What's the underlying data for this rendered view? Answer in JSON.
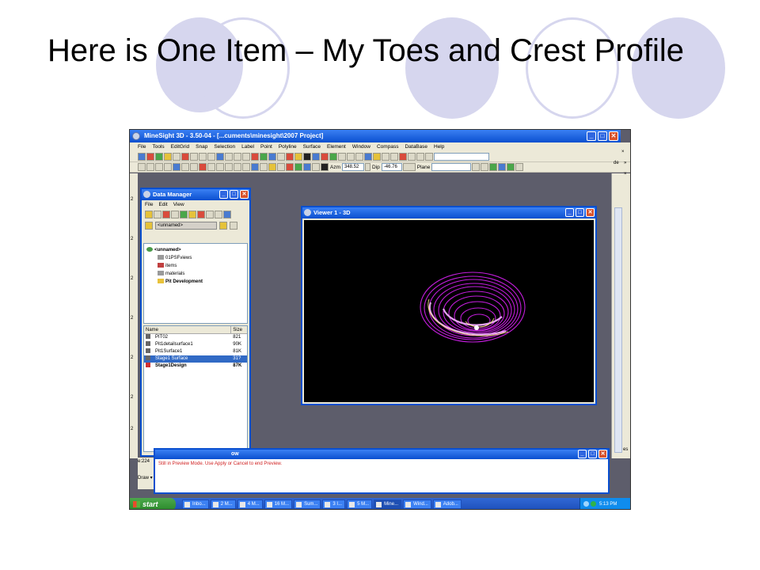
{
  "slide": {
    "title": "Here is One Item – My Toes and Crest Profile"
  },
  "app": {
    "window_title": "MineSight 3D  - 3.50-04 - [...cuments\\minesight\\2007 Project]",
    "menu": [
      "File",
      "Tools",
      "EditGrid",
      "Snap",
      "Selection",
      "Label",
      "Point",
      "Polyline",
      "Surface",
      "Element",
      "Window",
      "Compass",
      "DataBase",
      "Help"
    ],
    "toolbar2": {
      "azm_label": "Azm",
      "azm_value": "348.52",
      "dip_label": "Dip",
      "dip_value": "-46.76",
      "plane_label": "Plane"
    },
    "right_panel": {
      "de_label": "de",
      "es_label": "es"
    }
  },
  "data_manager": {
    "title": "Data Manager",
    "menu": [
      "File",
      "Edit",
      "View"
    ],
    "unnamed_field": "<unnamed>",
    "tree": {
      "root": "<unnamed>",
      "children": [
        "01PSFviews",
        "items",
        "materials",
        "Pit Development"
      ]
    },
    "list_headers": {
      "name": "Name",
      "size": "Size"
    },
    "list_rows": [
      {
        "name": "PIT02",
        "size": "821"
      },
      {
        "name": "Pit1detailsurface1",
        "size": "90K"
      },
      {
        "name": "Pit1Surface1",
        "size": "81K"
      },
      {
        "name": "Stage1 Surface",
        "size": "31?"
      },
      {
        "name": "Stage1Design",
        "size": "87K"
      }
    ]
  },
  "viewer": {
    "title": "Viewer 1 - 3D"
  },
  "message_window": {
    "title_partial": "ow",
    "message": "Still in Preview Mode. Use Apply or Cancel to end Preview."
  },
  "status": {
    "left_text": "e:224",
    "draw_label": "Draw ▾"
  },
  "taskbar": {
    "start_label": "start",
    "tasks": [
      "Inbo...",
      "2 M...",
      "4 M...",
      "16 M...",
      "Sum...",
      "3 I...",
      "5 M...",
      "Mine...",
      "Wind...",
      "Adob..."
    ],
    "active_task_index": 7,
    "clock": "5:13 PM"
  },
  "colors": {
    "circle": "#d6d6ee",
    "xp_blue": "#0a4fcf",
    "workspace": "#5d5d6b",
    "pit_magenta": "#c21ddb"
  }
}
